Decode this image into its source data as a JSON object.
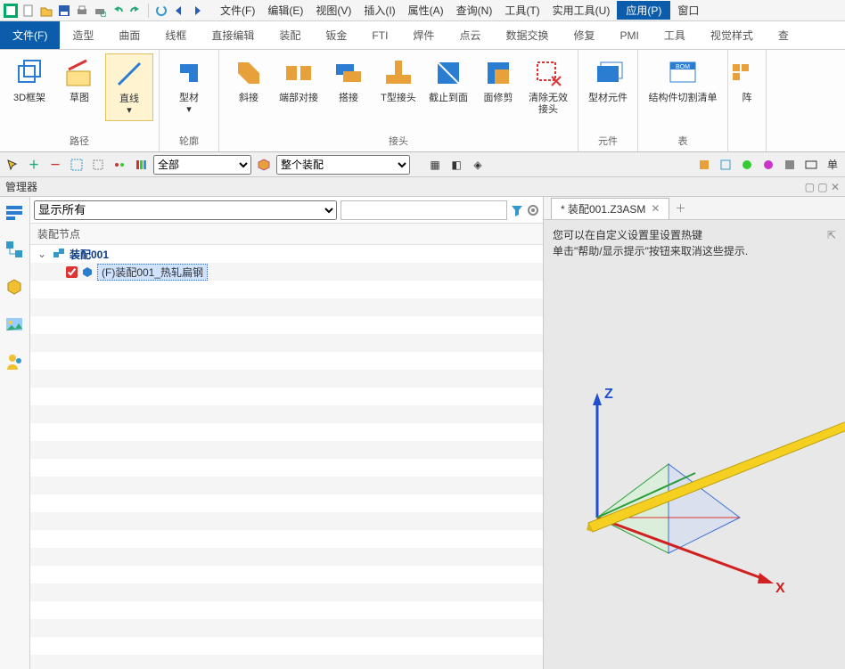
{
  "menubar": [
    "文件(F)",
    "编辑(E)",
    "视图(V)",
    "插入(I)",
    "属性(A)",
    "查询(N)",
    "工具(T)",
    "实用工具(U)",
    "应用(P)",
    "窗口"
  ],
  "ribbon_tabs": [
    "文件(F)",
    "造型",
    "曲面",
    "线框",
    "直接编辑",
    "装配",
    "钣金",
    "FTI",
    "焊件",
    "点云",
    "数据交换",
    "修复",
    "PMI",
    "工具",
    "视觉样式",
    "查"
  ],
  "ribbon_active_index": 0,
  "groups": {
    "path": {
      "label": "路径",
      "items": [
        "3D框架",
        "草图",
        "直线"
      ]
    },
    "contour": {
      "label": "轮廓",
      "items": [
        "型材"
      ]
    },
    "joint": {
      "label": "接头",
      "items": [
        "斜接",
        "端部对接",
        "搭接",
        "T型接头",
        "截止到面",
        "面修剪",
        "清除无效接头"
      ]
    },
    "component": {
      "label": "元件",
      "items": [
        "型材元件"
      ]
    },
    "table": {
      "label": "表",
      "items": [
        "结构件切割清单"
      ]
    },
    "extra": {
      "label": "",
      "items": [
        "阵"
      ]
    }
  },
  "toolstrip": {
    "combo1": "全部",
    "combo2": "整个装配"
  },
  "manager_title": "管理器",
  "tree": {
    "filter_label": "显示所有",
    "subhead": "装配节点",
    "root": "装配001",
    "child": "(F)装配001_热轧扁钢"
  },
  "doc_tab": "* 装配001.Z3ASM",
  "hint_line1": "您可以在自定义设置里设置热键",
  "hint_line2": "单击\"帮助/显示提示\"按钮来取消这些提示.",
  "axes": {
    "x": "X",
    "z": "Z"
  }
}
